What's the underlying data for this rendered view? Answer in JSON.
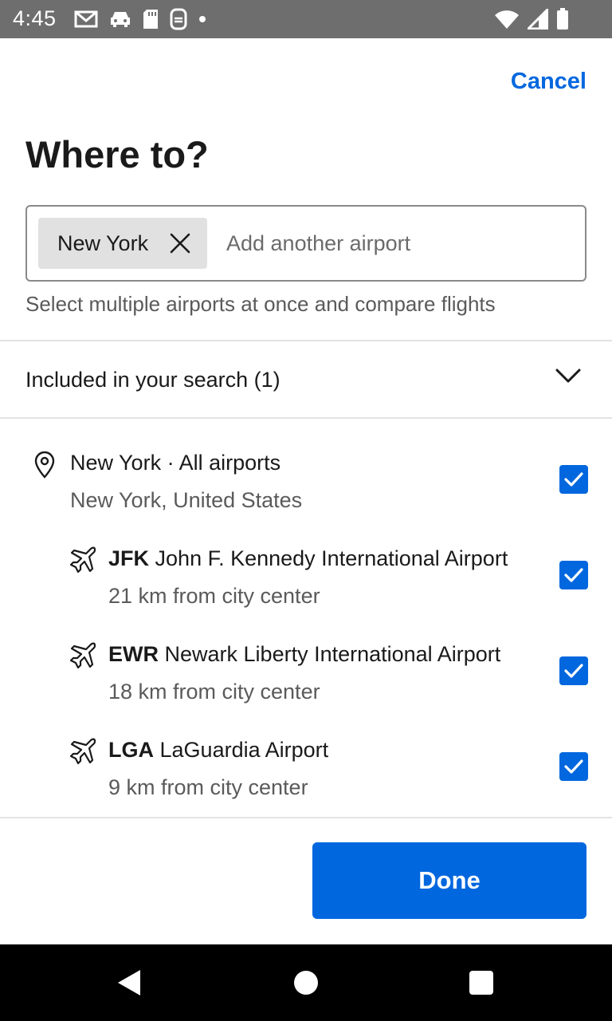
{
  "status_bar": {
    "time": "4:45",
    "left_icons": [
      "gmail-icon",
      "car-icon",
      "sd-card-icon",
      "sync-icon",
      "dot-icon"
    ],
    "right_icons": [
      "wifi-icon",
      "signal-icon",
      "battery-icon"
    ]
  },
  "header": {
    "cancel_label": "Cancel",
    "title": "Where to?"
  },
  "search": {
    "chip_label": "New York",
    "chip_remove_icon": "close-icon",
    "placeholder": "Add another airport",
    "helper": "Select multiple airports at once and compare flights"
  },
  "included": {
    "label": "Included in your search (1)",
    "icon": "chevron-down-icon"
  },
  "results": [
    {
      "icon": "location-pin-icon",
      "code": "",
      "title": "New York · All airports",
      "subtitle": "New York, United States",
      "checked": true
    },
    {
      "icon": "airplane-icon",
      "code": "JFK",
      "title": "John F. Kennedy International Airport",
      "subtitle": "21 km from city center",
      "checked": true
    },
    {
      "icon": "airplane-icon",
      "code": "EWR",
      "title": "Newark Liberty International Airport",
      "subtitle": "18 km from city center",
      "checked": true
    },
    {
      "icon": "airplane-icon",
      "code": "LGA",
      "title": "LaGuardia Airport",
      "subtitle": "9 km from city center",
      "checked": true
    }
  ],
  "footer": {
    "done_label": "Done"
  },
  "colors": {
    "accent": "#0067de",
    "status_bar": "#6e6e6e",
    "chip_bg": "#e1e1e1"
  },
  "nav_bar": {
    "icons": [
      "back-icon",
      "home-icon",
      "recents-icon"
    ]
  }
}
